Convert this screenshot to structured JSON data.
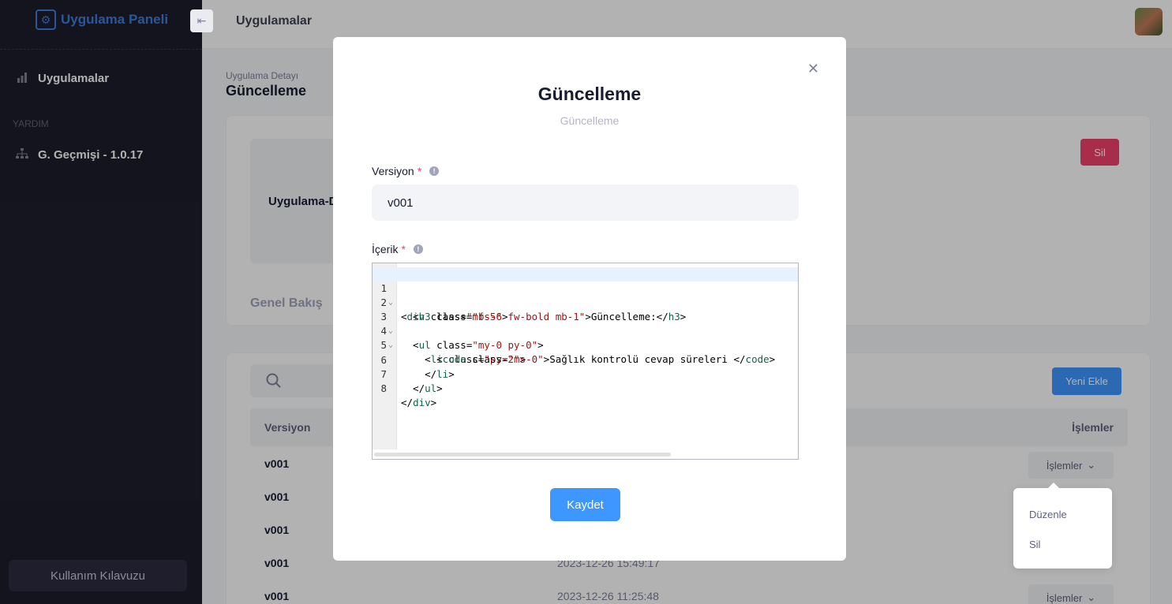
{
  "brand": {
    "name": "Uygulama Paneli"
  },
  "sidebar": {
    "items": [
      {
        "label": "Uygulamalar",
        "icon": "bar-chart-icon"
      }
    ],
    "section_label": "YARDIM",
    "help_items": [
      {
        "label": "G. Geçmişi - 1.0.17",
        "icon": "sitemap-icon"
      }
    ],
    "guide_button": "Kullanım Kılavuzu"
  },
  "header": {
    "title": "Uygulamalar"
  },
  "page": {
    "breadcrumb_sub": "Uygulama Detayı",
    "title": "Güncelleme",
    "app_name": "Uygulama-D",
    "delete_label": "Sil",
    "tab_overview": "Genel Bakış",
    "new_button": "Yeni Ekle",
    "table": {
      "col_version": "Versiyon",
      "col_actions": "İşlemler",
      "actions_label": "İşlemler",
      "rows": [
        {
          "version": "v001",
          "date": ""
        },
        {
          "version": "v001",
          "date": ""
        },
        {
          "version": "v001",
          "date": ""
        },
        {
          "version": "v001",
          "date": "2023-12-26 15:49:17"
        },
        {
          "version": "v001",
          "date": "2023-12-26 11:25:48"
        }
      ]
    }
  },
  "dropdown": {
    "edit": "Düzenle",
    "delete": "Sil"
  },
  "modal": {
    "title": "Güncelleme",
    "subtitle": "Güncelleme",
    "version_label": "Versiyon",
    "version_value": "v001",
    "content_label": "İçerik",
    "required_mark": "*",
    "save_label": "Kaydet",
    "code_lines": [
      {
        "n": "1",
        "fold": true
      },
      {
        "n": "2",
        "fold": false
      },
      {
        "n": "3",
        "fold": true
      },
      {
        "n": "4",
        "fold": true
      },
      {
        "n": "5",
        "fold": false
      },
      {
        "n": "6",
        "fold": false
      },
      {
        "n": "7",
        "fold": false
      },
      {
        "n": "8",
        "fold": false
      }
    ],
    "code": {
      "l1_tag": "div",
      "l1_attr": "class",
      "l1_val": "\"mb-5\"",
      "l2_tag": "h3",
      "l2_attr": "class",
      "l2_val": "\"fs-6 fw-bold mb-1\"",
      "l2_text": "Güncelleme:",
      "l3_tag": "ul",
      "l3_attr": "class",
      "l3_val": "\"my-0 py-0\"",
      "l4_tag": "li",
      "l4_attr": "class",
      "l4_val": "\"py-2\"",
      "l5_tag": "code",
      "l5_attr": "class",
      "l5_val": "\"ms-0\"",
      "l5_text": "Sağlık kontrolü cevap süreleri "
    }
  }
}
